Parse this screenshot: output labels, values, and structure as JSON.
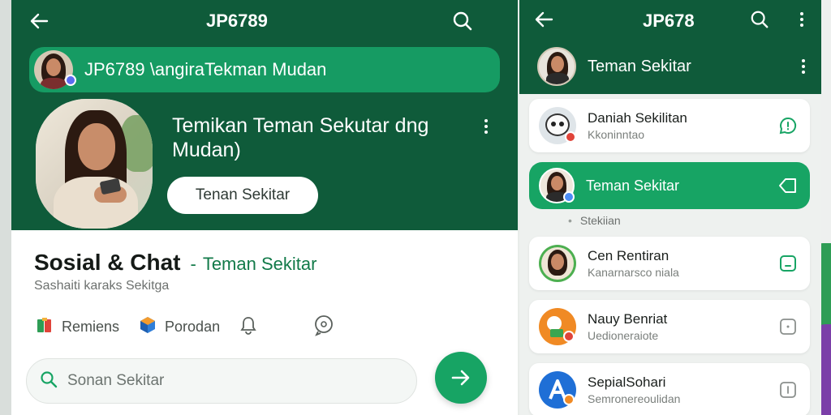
{
  "left_screen": {
    "title": "JP6789",
    "banner_text": "JP6789 \\angiraTekman Mudan",
    "hero_heading": "Temikan Teman Sekutar dng Mudan)",
    "hero_button": "Tenan Sekitar",
    "section_title": "Sosial & Chat",
    "section_dash": "-",
    "section_title_accent": "Teman Sekitar",
    "section_subtitle": "Sashaiti karaks Sekitga",
    "quick_actions": [
      {
        "label": "Remiens",
        "icon": "gift-icon"
      },
      {
        "label": "Porodan",
        "icon": "cube-icon"
      },
      {
        "label": "",
        "icon": "bell-icon"
      },
      {
        "label": "",
        "icon": "chat-icon"
      }
    ],
    "search_placeholder": "Sonan Sekitar",
    "colors": {
      "header": "#0f5b3a",
      "accent": "#17a464",
      "text_accent": "#127a49"
    }
  },
  "right_screen": {
    "title": "JP678",
    "profile_label": "Teman Sekitar",
    "contacts": [
      {
        "name": "Daniah Sekilitan",
        "sub": "Kkoninntao",
        "badge": "red",
        "action": "chat-bubble-icon"
      },
      {
        "name": "Teman Sekitar",
        "sub": "",
        "badge": "blue",
        "action": "tag-icon",
        "active": true
      },
      {
        "name": "Cen Rentiran",
        "sub": "Kanarnarsco niala",
        "badge": "",
        "action": "message-square-icon"
      },
      {
        "name": "Nauy Benriat",
        "sub": "Uedioneraiote",
        "badge": "red",
        "action": "square-icon"
      },
      {
        "name": "SepialSohari",
        "sub": "Semronereoulidan",
        "badge": "orange",
        "action": "square-icon"
      }
    ],
    "small_label": "Stekiian",
    "small_label_bullet": "•"
  }
}
